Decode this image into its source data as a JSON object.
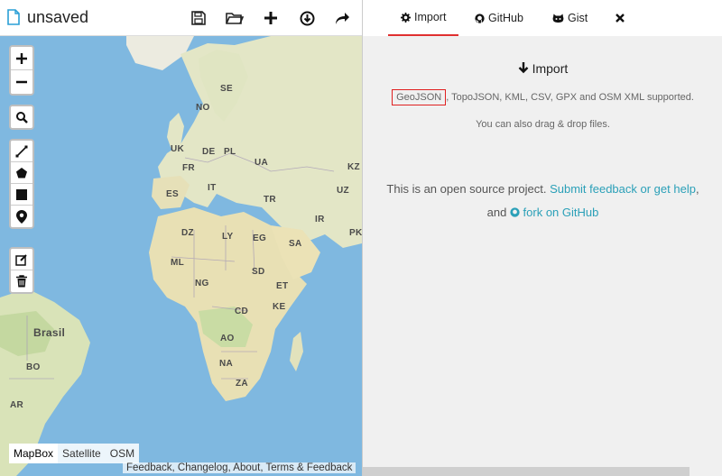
{
  "file": {
    "name": "unsaved"
  },
  "map": {
    "labels": [
      {
        "text": "SE"
      },
      {
        "text": "NO"
      },
      {
        "text": "UK"
      },
      {
        "text": "DE"
      },
      {
        "text": "PL"
      },
      {
        "text": "FR"
      },
      {
        "text": "UA"
      },
      {
        "text": "KZ"
      },
      {
        "text": "ES"
      },
      {
        "text": "IT"
      },
      {
        "text": "UZ"
      },
      {
        "text": "TR"
      },
      {
        "text": "IR"
      },
      {
        "text": "DZ"
      },
      {
        "text": "LY"
      },
      {
        "text": "EG"
      },
      {
        "text": "SA"
      },
      {
        "text": "PK"
      },
      {
        "text": "ML"
      },
      {
        "text": "SD"
      },
      {
        "text": "NG"
      },
      {
        "text": "ET"
      },
      {
        "text": "KE"
      },
      {
        "text": "CD"
      },
      {
        "text": "Brasil"
      },
      {
        "text": "AO"
      },
      {
        "text": "BO"
      },
      {
        "text": "NA"
      },
      {
        "text": "ZA"
      },
      {
        "text": "AR"
      }
    ],
    "layers": [
      "MapBox",
      "Satellite",
      "OSM"
    ],
    "attribution": "Feedback, Changelog, About, Terms & Feedback"
  },
  "tabs": {
    "import": "Import",
    "github": "GitHub",
    "gist": "Gist"
  },
  "panel": {
    "title": "Import",
    "geojson": "GeoJSON",
    "supported_rest": ", TopoJSON, KML, CSV, GPX and OSM XML supported.",
    "dragdrop": "You can also drag & drop files.",
    "opensource_pre": "This is an open source project. ",
    "feedback_link": "Submit feedback or get help",
    "opensource_mid": ",",
    "and": "and ",
    "fork_link": "fork on GitHub"
  },
  "colors": {
    "accent": "#2ba0b8",
    "active_tab": "#e03030",
    "water": "#7fb8e0",
    "land": "#e8e4c8"
  }
}
